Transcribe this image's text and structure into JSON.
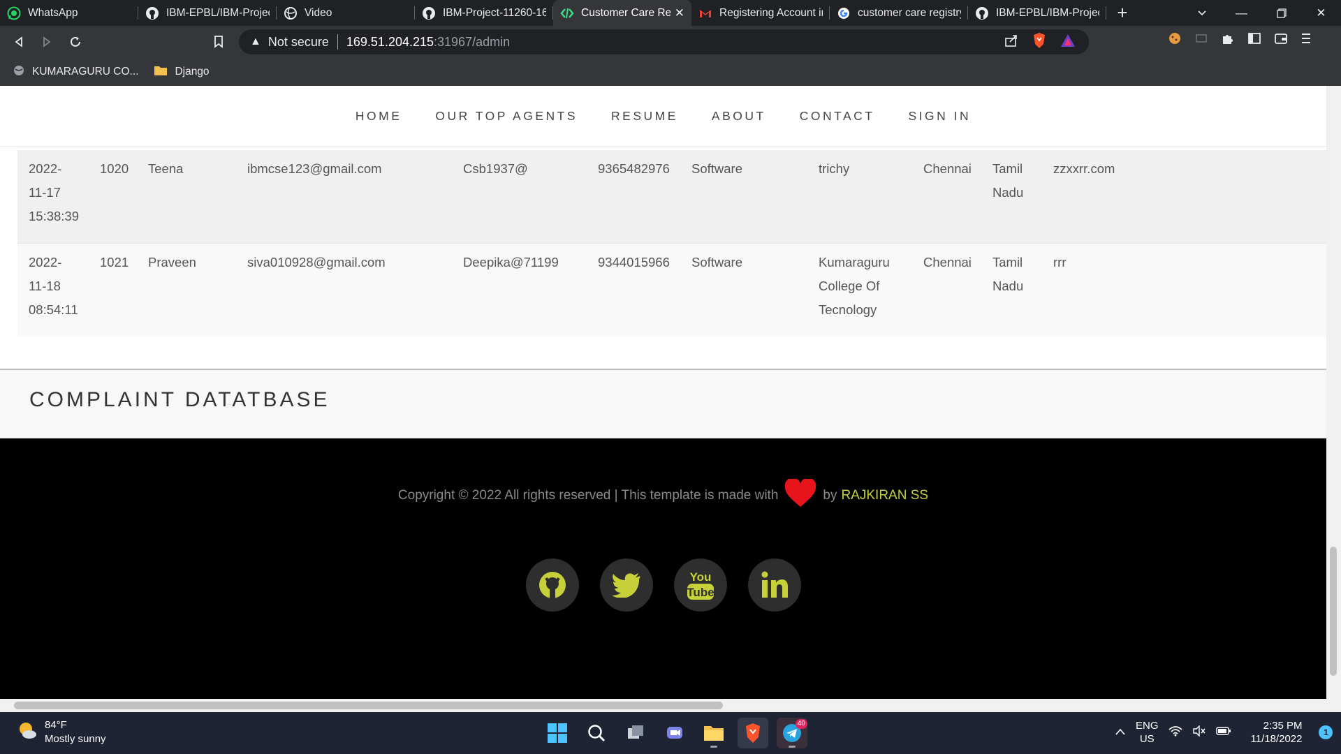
{
  "browser": {
    "tabs": [
      {
        "icon": "whatsapp-icon",
        "label": "WhatsApp",
        "active": false
      },
      {
        "icon": "github-icon",
        "label": "IBM-EPBL/IBM-Project",
        "active": false
      },
      {
        "icon": "globe-icon",
        "label": "Video",
        "active": false
      },
      {
        "icon": "github-icon",
        "label": "IBM-Project-11260-16",
        "active": false
      },
      {
        "icon": "code-icon",
        "label": "Customer Care Reg",
        "active": true
      },
      {
        "icon": "gmail-icon",
        "label": "Registering Account in",
        "active": false
      },
      {
        "icon": "google-icon",
        "label": "customer care registry",
        "active": false
      },
      {
        "icon": "github-icon",
        "label": "IBM-EPBL/IBM-Project",
        "active": false
      }
    ],
    "address": {
      "security_label": "Not secure",
      "host": "169.51.204.215",
      "path": ":31967/admin"
    },
    "bookmarks": [
      {
        "icon": "globe-icon",
        "label": "KUMARAGURU CO..."
      },
      {
        "icon": "folder-icon",
        "label": "Django"
      }
    ]
  },
  "site": {
    "nav": [
      "HOME",
      "OUR TOP AGENTS",
      "RESUME",
      "ABOUT",
      "CONTACT",
      "SIGN IN"
    ],
    "rows": [
      {
        "datetime": [
          "2022-",
          "11-17",
          "15:38:39"
        ],
        "id": "1020",
        "name": "Teena",
        "email": "ibmcse123@gmail.com",
        "password": "Csb1937@",
        "phone": "9365482976",
        "category": "Software",
        "address": [
          "trichy"
        ],
        "city": "Chennai",
        "state": [
          "Tamil",
          "Nadu"
        ],
        "extra": "zzxxrr.com"
      },
      {
        "datetime": [
          "2022-",
          "11-18",
          "08:54:11"
        ],
        "id": "1021",
        "name": "Praveen",
        "email": "siva010928@gmail.com",
        "password": "Deepika@71199",
        "phone": "9344015966",
        "category": "Software",
        "address": [
          "Kumaraguru",
          "College Of",
          "Tecnology"
        ],
        "city": "Chennai",
        "state": [
          "Tamil",
          "Nadu"
        ],
        "extra": "rrr"
      }
    ],
    "complaint_heading": "COMPLAINT DATATBASE",
    "footer": {
      "copyright": "Copyright © 2022 All rights reserved | This template is made with",
      "by": "by",
      "author": "RAJKIRAN SS",
      "socials": [
        "github-icon",
        "twitter-icon",
        "youtube-icon",
        "linkedin-icon"
      ]
    },
    "colors": {
      "accent": "#c6d13a",
      "heart": "#e8141c",
      "footer_bg": "#000000"
    }
  },
  "taskbar": {
    "weather_temp": "84°F",
    "weather_desc": "Mostly sunny",
    "lang_line1": "ENG",
    "lang_line2": "US",
    "time": "2:35 PM",
    "date": "11/18/2022",
    "notification_count": "1",
    "telegram_badge": "40"
  }
}
